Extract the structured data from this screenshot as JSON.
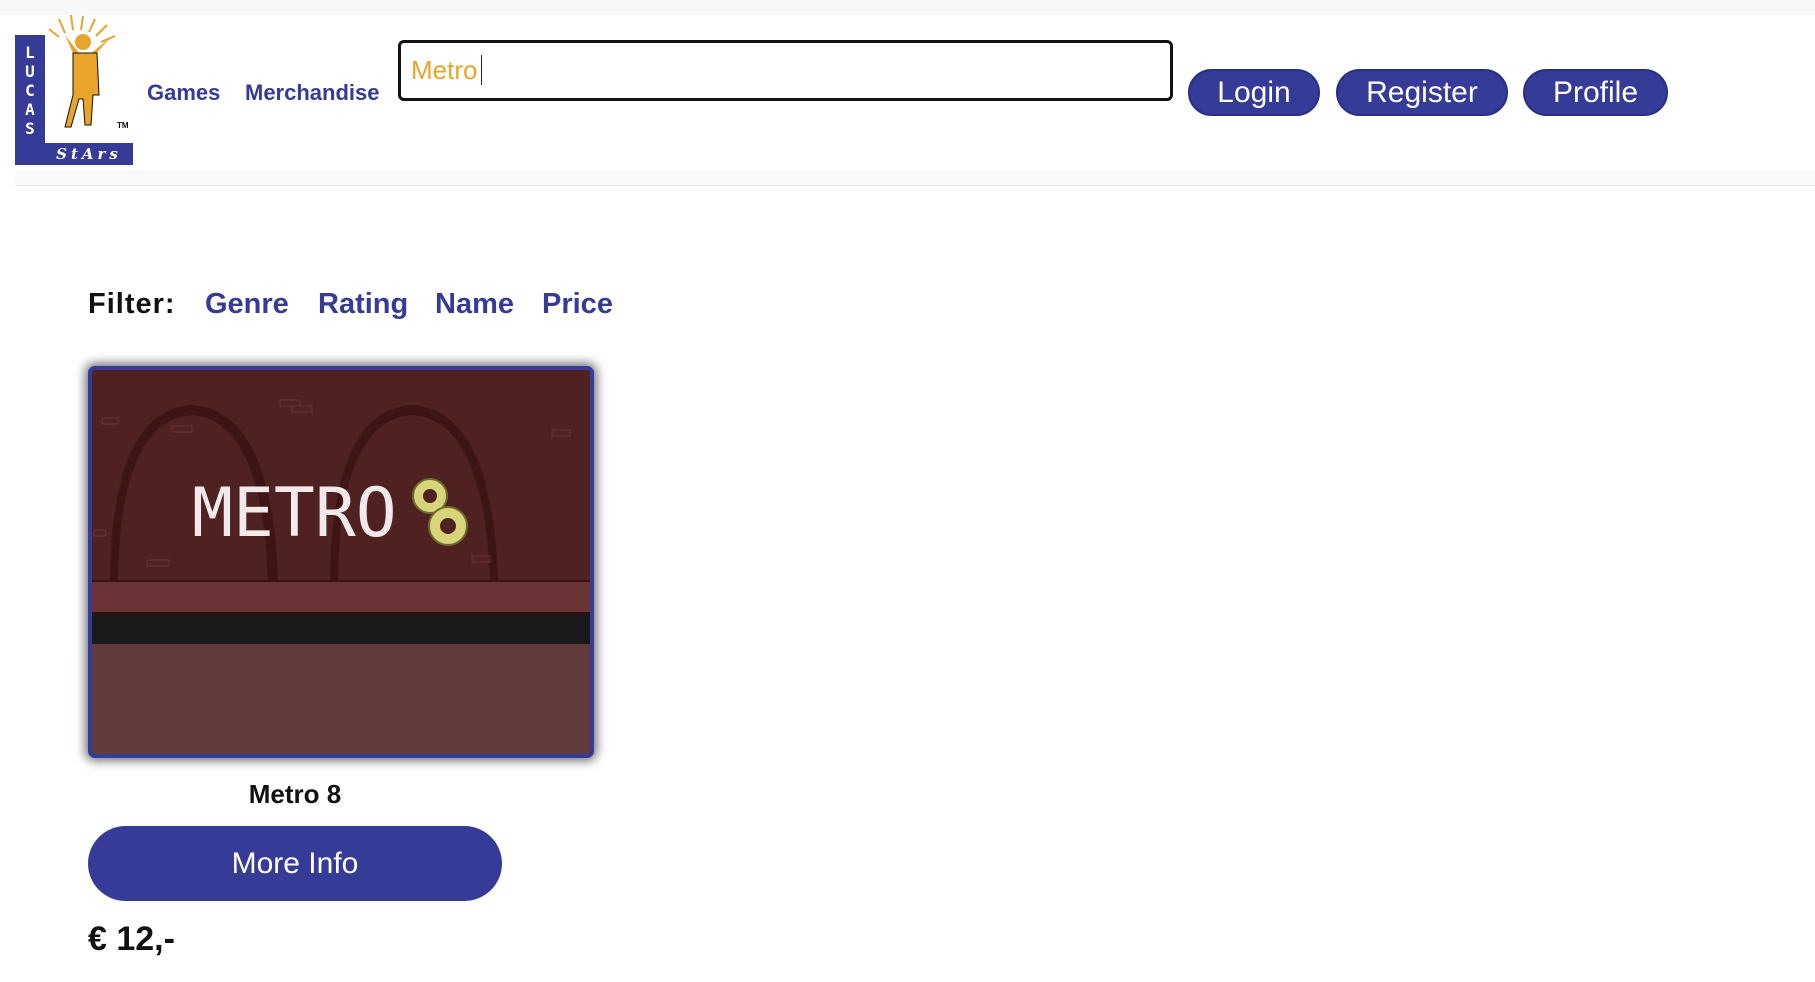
{
  "logo": {
    "letters": "LUCAS",
    "script": "StArs",
    "tm": "TM",
    "colors": {
      "brand_blue": "#363b97",
      "figure_gold": "#e8a52a"
    }
  },
  "nav": {
    "games_label": "Games",
    "merchandise_label": "Merchandise"
  },
  "search": {
    "value": "Metro",
    "text_color": "#e8a52a"
  },
  "header_buttons": {
    "login_label": "Login",
    "register_label": "Register",
    "profile_label": "Profile"
  },
  "filter": {
    "label": "Filter:",
    "options": [
      "Genre",
      "Rating",
      "Name",
      "Price"
    ]
  },
  "results": [
    {
      "title": "Metro 8",
      "image_text": "METRO",
      "button_label": "More Info",
      "price": "€ 12,-"
    }
  ],
  "colors": {
    "accent": "#363b97",
    "page_bg": "#ffffff"
  }
}
